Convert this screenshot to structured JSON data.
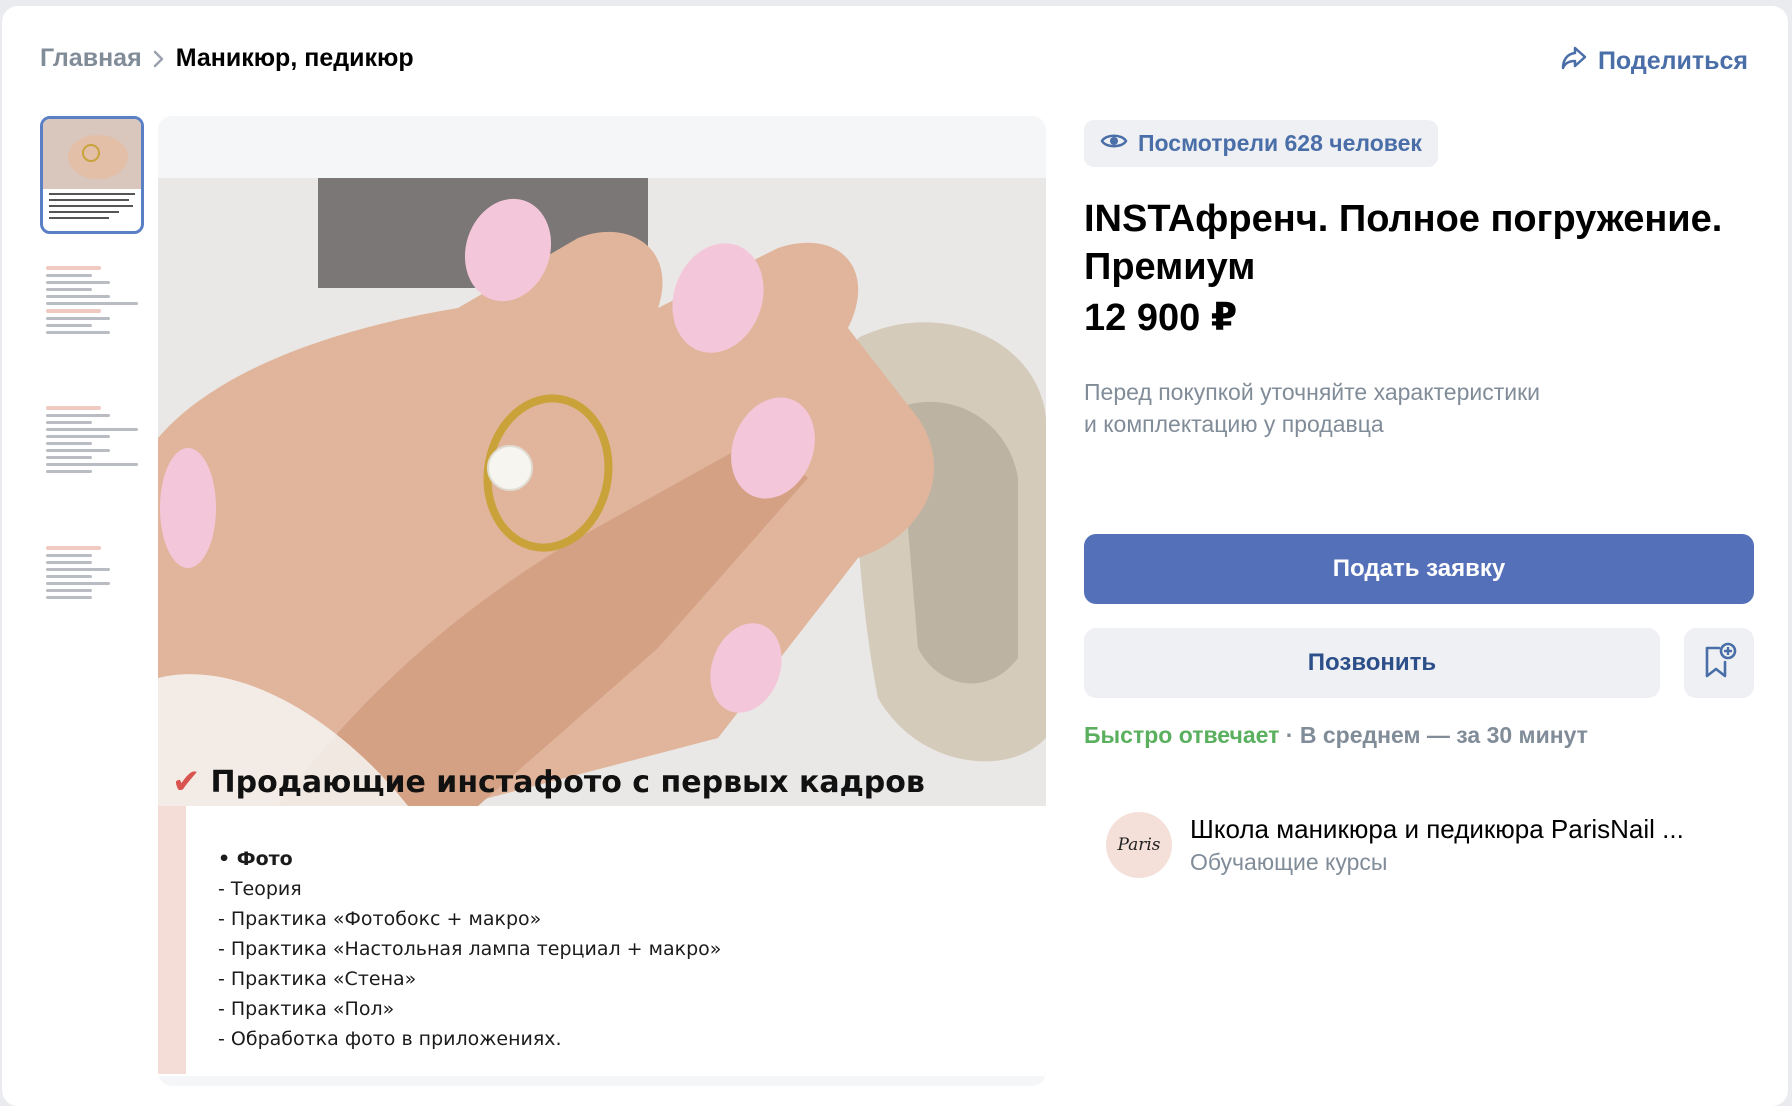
{
  "breadcrumb": {
    "home": "Главная",
    "current": "Маникюр, педикюр"
  },
  "share": {
    "label": "Поделиться"
  },
  "views": {
    "label": "Посмотрели 628 человек"
  },
  "product": {
    "title": "INSTAфренч. Полное погружение. Премиум",
    "price": "12 900 ₽",
    "note_line1": "Перед покупкой уточняйте характеристики",
    "note_line2": "и комплектацию у продавца"
  },
  "buttons": {
    "apply": "Подать заявку",
    "call": "Позвонить"
  },
  "reply": {
    "fast": "Быстро отвечает",
    "avg": " · В среднем — за 30 минут"
  },
  "seller": {
    "name": "Школа маникюра и педикюра ParisNail ...",
    "category": "Обучающие курсы",
    "avatar_text": "Paris"
  },
  "gallery": {
    "caption": "Продающие инстафото с первых кадров",
    "list": [
      "• Фото",
      "- Теория",
      " - Практика «Фотобокс + макро»",
      " - Практика «Настольная лампа терциал + макро»",
      " - Практика «Стена»",
      " - Практика «Пол»",
      " - Обработка фото в приложениях."
    ]
  },
  "colors": {
    "accent": "#5470b8",
    "link": "#4a6ea8",
    "muted": "#818c99",
    "success": "#5ab05e"
  },
  "icons": {
    "share": "share-arrow-icon",
    "views": "eye-icon",
    "fav": "bookmark-add-icon"
  }
}
